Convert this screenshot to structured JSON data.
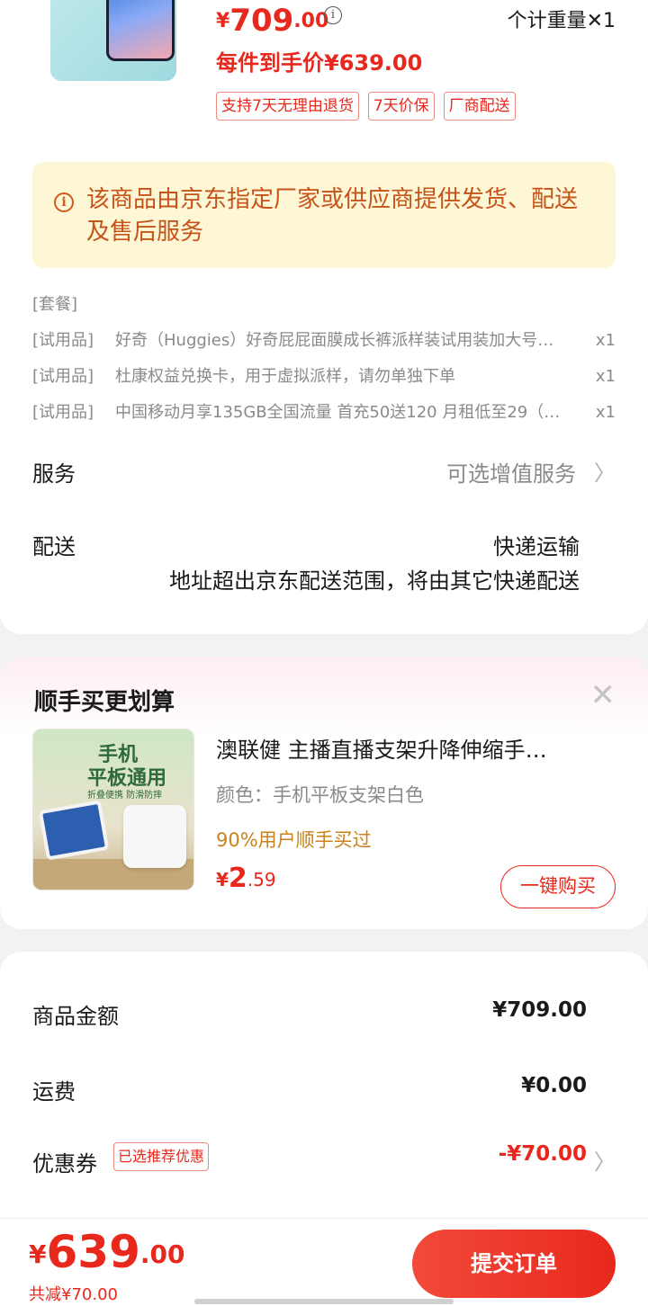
{
  "product": {
    "price_currency": "¥",
    "price_int": "709",
    "price_dec": ".00",
    "info_icon": "ⓘ",
    "weight_text": "个计重量✕1",
    "unit_price": "每件到手价¥639.00",
    "tags": [
      "支持7天无理由退货",
      "7天价保",
      "厂商配送"
    ]
  },
  "notice": {
    "icon": "i",
    "text": "该商品由京东指定厂家或供应商提供发货、配送及售后服务"
  },
  "bundle": {
    "header": "[套餐]",
    "items": [
      {
        "type": "[试用品]",
        "name": "好奇（Huggies）好奇屁屁面膜成长裤派样装试用装加大号…",
        "qty": "x1"
      },
      {
        "type": "[试用品]",
        "name": "杜康权益兑换卡，用于虚拟派样，请勿单独下单",
        "qty": "x1"
      },
      {
        "type": "[试用品]",
        "name": "中国移动月享135GB全国流量 首充50送120 月租低至29（…",
        "qty": "x1"
      }
    ]
  },
  "service": {
    "label": "服务",
    "value": "可选增值服务",
    "chevron": "〉"
  },
  "delivery": {
    "label": "配送",
    "value": "快递运输",
    "sub": "地址超出京东配送范围，将由其它快递配送"
  },
  "addon": {
    "title": "顺手买更划算",
    "close": "✕",
    "image_text_1": "手机",
    "image_text_2": "平板通用",
    "image_text_3": "折叠便携 防滑防摔",
    "name": "澳联健 主播直播支架升降伸缩手…",
    "color": "颜色：手机平板支架白色",
    "popularity": "90%用户顺手买过",
    "price_currency": "¥",
    "price_int": "2",
    "price_dec": ".59",
    "buy_label": "一键购买"
  },
  "summary": {
    "goods_label": "商品金额",
    "goods_value": "¥709.00",
    "shipping_label": "运费",
    "shipping_value": "¥0.00",
    "coupon_label": "优惠券",
    "coupon_tag": "已选推荐优惠",
    "coupon_value": "-¥70.00",
    "chevron": "〉"
  },
  "footer": {
    "currency": "¥",
    "total_int": "639",
    "total_dec": ".00",
    "reduced": "共减¥70.00",
    "submit_label": "提交订单"
  },
  "colors": {
    "accent": "#e8281d",
    "notice_bg": "#fdf7d6",
    "notice_text": "#c8531a",
    "popularity": "#c8831a"
  }
}
